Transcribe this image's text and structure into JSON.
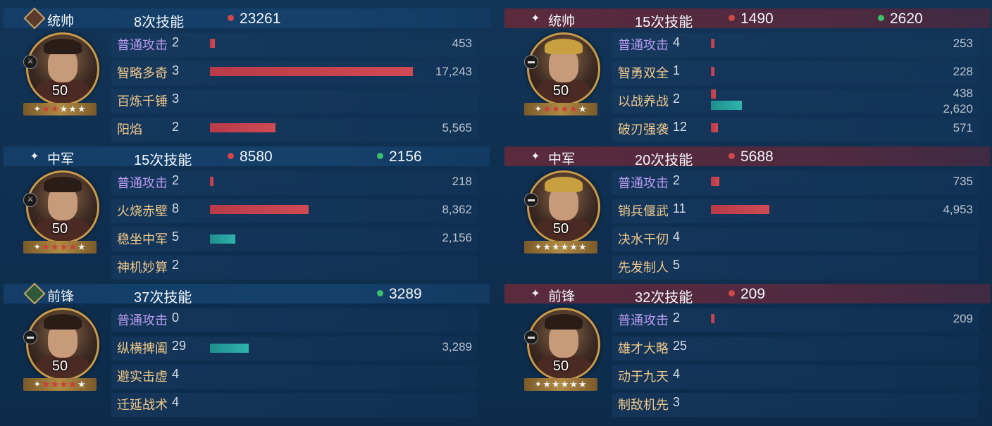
{
  "colors": {
    "damage": "#d04848",
    "heal": "#3cbf6a",
    "bar_damage": "#c8424e",
    "bar_heal": "#28a6a1"
  },
  "teams": [
    {
      "side": "left",
      "generals": [
        {
          "role": "统帅",
          "role_icon": "diamond-sword-icon",
          "skill_count": "8次技能",
          "damage": "23261",
          "heal": "",
          "level": "50",
          "stars_red": 2,
          "stars_white": 3,
          "unit_icon": "spear-icon",
          "skills": [
            {
              "name": "普通攻击",
              "count": "2",
              "dmg": "453",
              "dmg_frac": 0.026,
              "heal": "",
              "heal_frac": 0,
              "type": "normal"
            },
            {
              "name": "智略多奇",
              "count": "3",
              "dmg": "17,243",
              "dmg_frac": 1.0,
              "heal": "",
              "heal_frac": 0,
              "type": "skill"
            },
            {
              "name": "百炼千锤",
              "count": "3",
              "dmg": "",
              "dmg_frac": 0,
              "heal": "",
              "heal_frac": 0,
              "type": "skill"
            },
            {
              "name": "阳焰",
              "count": "2",
              "dmg": "5,565",
              "dmg_frac": 0.323,
              "heal": "",
              "heal_frac": 0,
              "type": "skill"
            }
          ]
        },
        {
          "role": "中军",
          "role_icon": "spark-icon",
          "skill_count": "15次技能",
          "damage": "8580",
          "heal": "2156",
          "level": "50",
          "stars_red": 4,
          "stars_white": 1,
          "unit_icon": "spear-icon",
          "skills": [
            {
              "name": "普通攻击",
              "count": "2",
              "dmg": "218",
              "dmg_frac": 0.013,
              "heal": "",
              "heal_frac": 0,
              "type": "normal"
            },
            {
              "name": "火烧赤壁",
              "count": "8",
              "dmg": "8,362",
              "dmg_frac": 0.485,
              "heal": "",
              "heal_frac": 0,
              "type": "skill"
            },
            {
              "name": "稳坐中军",
              "count": "5",
              "dmg": "",
              "dmg_frac": 0,
              "heal": "2,156",
              "heal_frac": 0.125,
              "type": "skill"
            },
            {
              "name": "神机妙算",
              "count": "2",
              "dmg": "",
              "dmg_frac": 0,
              "heal": "",
              "heal_frac": 0,
              "type": "skill"
            }
          ]
        },
        {
          "role": "前锋",
          "role_icon": "diamond-heart-icon",
          "skill_count": "37次技能",
          "damage": "",
          "heal": "3289",
          "level": "50",
          "stars_red": 4,
          "stars_white": 1,
          "unit_icon": "cavalry-icon",
          "skills": [
            {
              "name": "普通攻击",
              "count": "0",
              "dmg": "",
              "dmg_frac": 0,
              "heal": "",
              "heal_frac": 0,
              "type": "normal"
            },
            {
              "name": "纵横捭阖",
              "count": "29",
              "dmg": "",
              "dmg_frac": 0,
              "heal": "3,289",
              "heal_frac": 0.191,
              "type": "skill"
            },
            {
              "name": "避实击虚",
              "count": "4",
              "dmg": "",
              "dmg_frac": 0,
              "heal": "",
              "heal_frac": 0,
              "type": "skill"
            },
            {
              "name": "迁延战术",
              "count": "4",
              "dmg": "",
              "dmg_frac": 0,
              "heal": "",
              "heal_frac": 0,
              "type": "skill"
            }
          ]
        }
      ]
    },
    {
      "side": "right",
      "generals": [
        {
          "role": "统帅",
          "role_icon": "spark-icon",
          "skill_count": "15次技能",
          "damage": "1490",
          "heal": "2620",
          "level": "50",
          "stars_red": 4,
          "stars_white": 1,
          "unit_icon": "cavalry-icon",
          "skills": [
            {
              "name": "普通攻击",
              "count": "4",
              "dmg": "253",
              "dmg_frac": 0.015,
              "heal": "",
              "heal_frac": 0,
              "type": "normal"
            },
            {
              "name": "智勇双全",
              "count": "1",
              "dmg": "228",
              "dmg_frac": 0.013,
              "heal": "",
              "heal_frac": 0,
              "type": "skill"
            },
            {
              "name": "以战养战",
              "count": "2",
              "dmg": "438",
              "dmg_frac": 0.025,
              "heal": "2,620",
              "heal_frac": 0.152,
              "type": "skill"
            },
            {
              "name": "破刃强袭",
              "count": "12",
              "dmg": "571",
              "dmg_frac": 0.033,
              "heal": "",
              "heal_frac": 0,
              "type": "skill"
            }
          ]
        },
        {
          "role": "中军",
          "role_icon": "spark-icon",
          "skill_count": "20次技能",
          "damage": "5688",
          "heal": "",
          "level": "50",
          "stars_red": 0,
          "stars_white": 5,
          "unit_icon": "cavalry-icon",
          "skills": [
            {
              "name": "普通攻击",
              "count": "2",
              "dmg": "735",
              "dmg_frac": 0.043,
              "heal": "",
              "heal_frac": 0,
              "type": "normal"
            },
            {
              "name": "销兵偃武",
              "count": "11",
              "dmg": "4,953",
              "dmg_frac": 0.287,
              "heal": "",
              "heal_frac": 0,
              "type": "skill"
            },
            {
              "name": "决水干仞",
              "count": "4",
              "dmg": "",
              "dmg_frac": 0,
              "heal": "",
              "heal_frac": 0,
              "type": "skill"
            },
            {
              "name": "先发制人",
              "count": "5",
              "dmg": "",
              "dmg_frac": 0,
              "heal": "",
              "heal_frac": 0,
              "type": "skill"
            }
          ]
        },
        {
          "role": "前锋",
          "role_icon": "spark-icon",
          "skill_count": "32次技能",
          "damage": "209",
          "heal": "",
          "level": "50",
          "stars_red": 0,
          "stars_white": 5,
          "unit_icon": "cavalry-icon",
          "skills": [
            {
              "name": "普通攻击",
              "count": "2",
              "dmg": "209",
              "dmg_frac": 0.012,
              "heal": "",
              "heal_frac": 0,
              "type": "normal"
            },
            {
              "name": "雄才大略",
              "count": "25",
              "dmg": "",
              "dmg_frac": 0,
              "heal": "",
              "heal_frac": 0,
              "type": "skill"
            },
            {
              "name": "动于九天",
              "count": "4",
              "dmg": "",
              "dmg_frac": 0,
              "heal": "",
              "heal_frac": 0,
              "type": "skill"
            },
            {
              "name": "制敌机先",
              "count": "3",
              "dmg": "",
              "dmg_frac": 0,
              "heal": "",
              "heal_frac": 0,
              "type": "skill"
            }
          ]
        }
      ]
    }
  ]
}
